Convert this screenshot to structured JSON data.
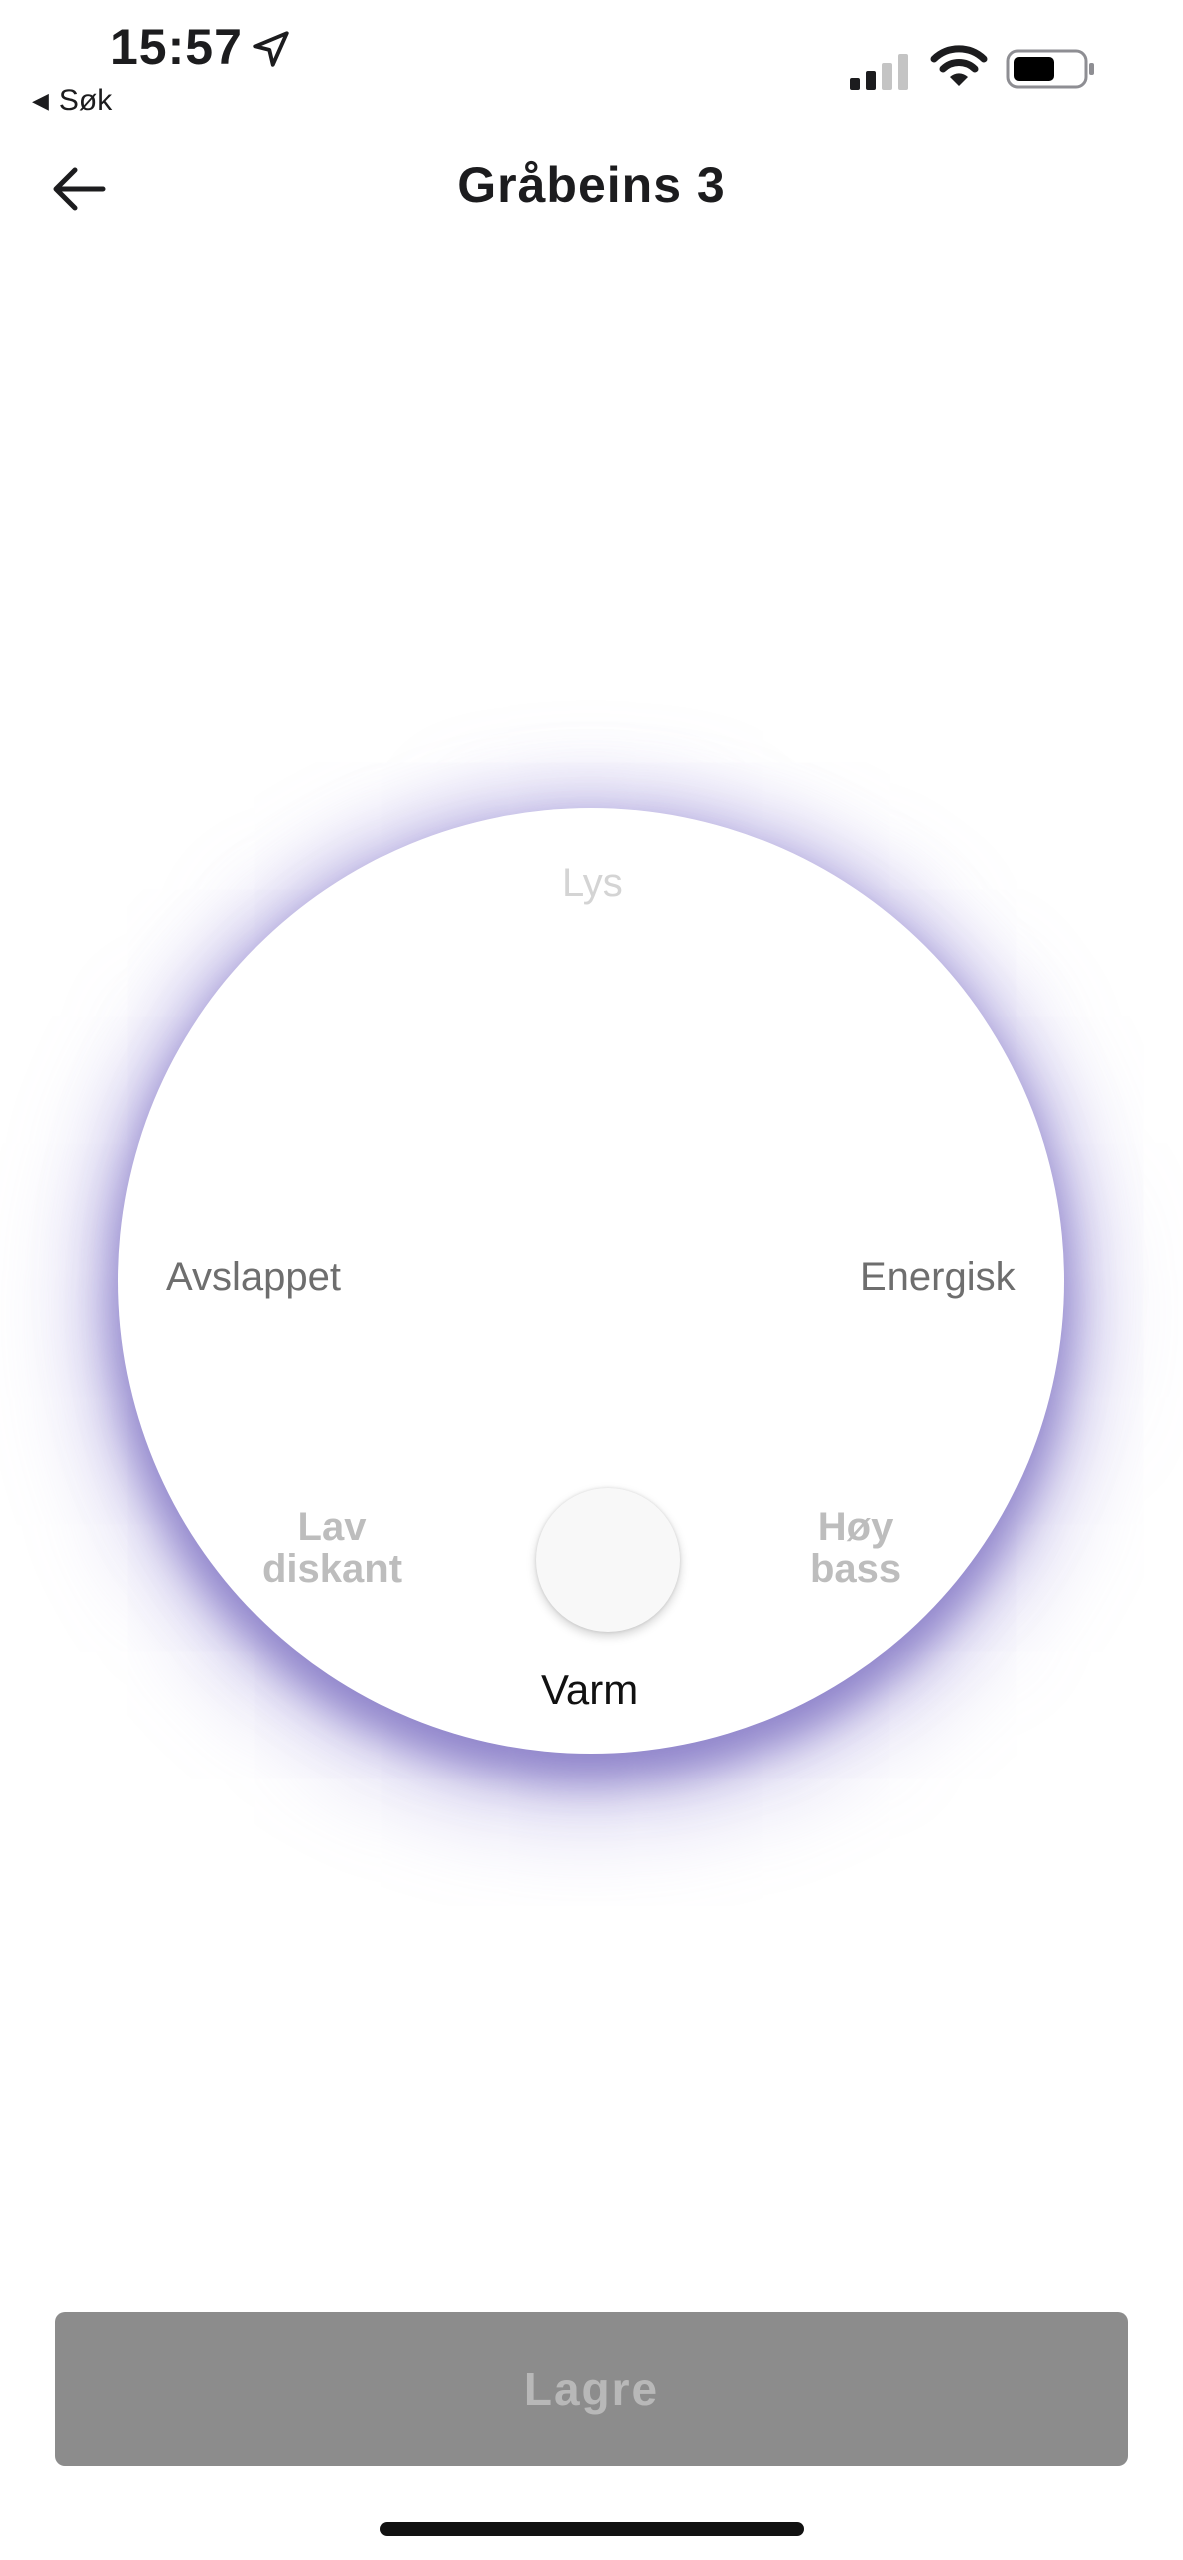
{
  "status_bar": {
    "time": "15:57",
    "back_app_label": "Søk",
    "icons": [
      "location-arrow-icon",
      "cellular-signal-icon",
      "wifi-icon",
      "battery-icon"
    ]
  },
  "nav": {
    "title": "Gråbeins 3",
    "back_icon": "arrow-left-icon"
  },
  "wheel": {
    "labels": {
      "top": "Lys",
      "left": "Avslappet",
      "right": "Energisk",
      "bottom_left_1": "Lav",
      "bottom_left_2": "diskant",
      "bottom_right_1": "Høy",
      "bottom_right_2": "bass",
      "bottom": "Varm"
    },
    "selected": "Varm",
    "glow_color": "#5c4eaf"
  },
  "actions": {
    "save_label": "Lagre",
    "save_color": "#8c8c8c"
  }
}
